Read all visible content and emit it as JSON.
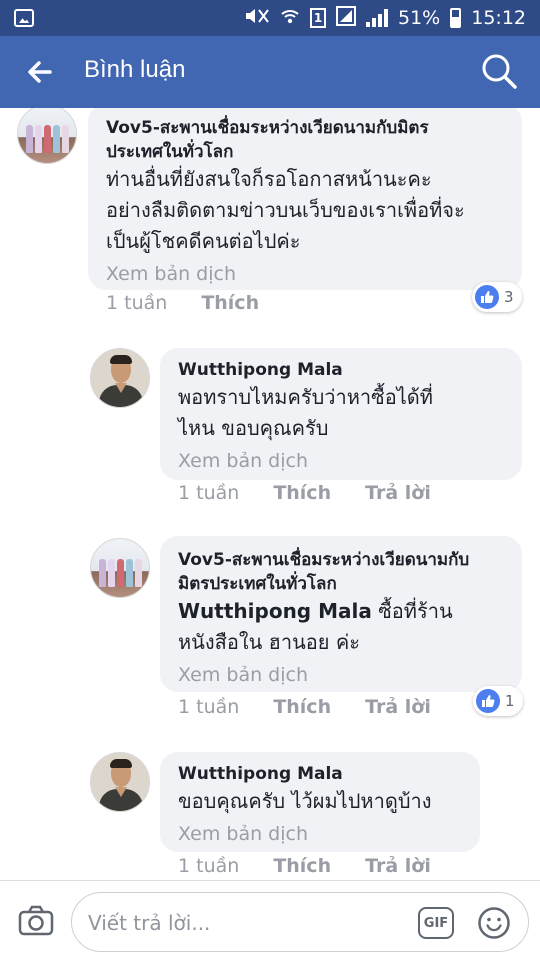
{
  "status_bar": {
    "sim_label": "1",
    "battery_percent": "51%",
    "time": "15:12"
  },
  "app_bar": {
    "title": "Bình luận"
  },
  "comments": [
    {
      "author": "Vov5-สะพานเชื่อมระหว่างเวียดนามกับมิตรประเทศในทั่วโลก",
      "author_line1": "Vov5-สะพานเชื่อมระหว่างเวียดนามกับมิตร",
      "author_line2": "ประเทศในทั่วโลก",
      "text_line1": "ท่านอื่นที่ยังสนใจก็รอโอกาสหน้านะคะ",
      "text_line2": "อย่างลืมติดตามข่าวบนเว็บของเราเพื่อที่จะ",
      "text_line3": "เป็นผู้โชคดีคนต่อไปค่ะ",
      "translate": "Xem bản dịch",
      "time": "1 tuần",
      "like_label": "Thích",
      "reaction_count": "3"
    },
    {
      "author": "Wutthipong Mala",
      "text_line1": "พอทราบไหมครับว่าหาซื้อได้ที่",
      "text_line2": "ไหน ขอบคุณครับ",
      "translate": "Xem bản dịch",
      "time": "1 tuần",
      "like_label": "Thích",
      "reply_label": "Trả lời"
    },
    {
      "author_line1": "Vov5-สะพานเชื่อมระหว่างเวียดนามกับ",
      "author_line2": "มิตรประเทศในทั่วโลก",
      "mention": "Wutthipong Mala",
      "text_line1_rest": " ซื้อที่ร้าน",
      "text_line2": "หนังสือใน ฮานอย ค่ะ",
      "translate": "Xem bản dịch",
      "time": "1 tuần",
      "like_label": "Thích",
      "reply_label": "Trả lời",
      "reaction_count": "1"
    },
    {
      "author": "Wutthipong Mala",
      "text_line1": "ขอบคุณครับ ไว้ผมไปหาดูบ้าง",
      "translate": "Xem bản dịch",
      "time": "1 tuần",
      "like_label": "Thích",
      "reply_label": "Trả lời"
    }
  ],
  "composer": {
    "placeholder": "Viết trả lời...",
    "gif_label": "GIF"
  },
  "icons": {
    "back": "arrow-left-icon",
    "search": "search-icon",
    "camera": "camera-icon",
    "emoji": "smiley-icon",
    "like": "thumbs-up-icon"
  },
  "colors": {
    "status_bar": "#2e4b88",
    "app_bar": "#4267b2",
    "bubble": "#f1f2f6",
    "like_blue": "#4c7ef0",
    "meta_gray": "#9a9da5"
  }
}
